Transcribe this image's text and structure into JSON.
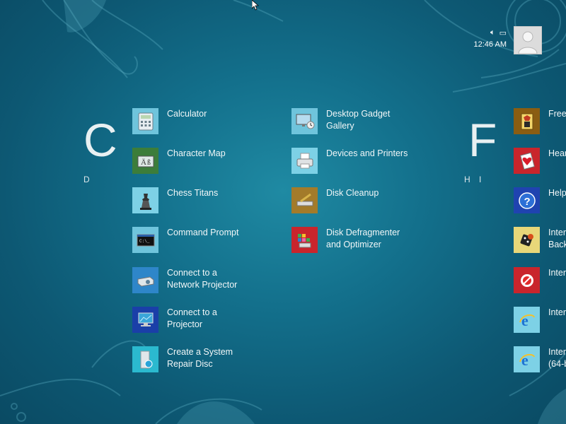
{
  "status": {
    "time": "12:46 AM"
  },
  "groups": {
    "c": {
      "letter": "C",
      "nav": "D"
    },
    "f": {
      "letter": "F",
      "nav_h": "H",
      "nav_i": "I"
    }
  },
  "apps": {
    "col1": [
      {
        "label": "Calculator",
        "icon": "calculator-icon",
        "color": "#6fc4dc"
      },
      {
        "label": "Character Map",
        "icon": "character-map-icon",
        "color": "#3c7d3a"
      },
      {
        "label": "Chess Titans",
        "icon": "chess-icon",
        "color": "#7dd1e6"
      },
      {
        "label": "Command Prompt",
        "icon": "command-prompt-icon",
        "color": "#6fc4dc"
      },
      {
        "label": "Connect to a\nNetwork Projector",
        "icon": "network-projector-icon",
        "color": "#2e86c9"
      },
      {
        "label": "Connect to a\nProjector",
        "icon": "projector-icon",
        "color": "#1a3fa8"
      },
      {
        "label": "Create a System\nRepair Disc",
        "icon": "repair-disc-icon",
        "color": "#2bb9cf"
      }
    ],
    "col2": [
      {
        "label": "Desktop Gadget\nGallery",
        "icon": "gadget-gallery-icon",
        "color": "#6fc4dc"
      },
      {
        "label": "Devices and Printers",
        "icon": "printer-icon",
        "color": "#7dd1e6"
      },
      {
        "label": "Disk Cleanup",
        "icon": "disk-cleanup-icon",
        "color": "#a37b2a"
      },
      {
        "label": "Disk Defragmenter\nand Optimizer",
        "icon": "defragmenter-icon",
        "color": "#c9252c"
      }
    ],
    "col3": [
      {
        "label": "Free",
        "icon": "freecell-icon",
        "color": "#8a5d12"
      },
      {
        "label": "Hear",
        "icon": "hearts-icon",
        "color": "#c9252c"
      },
      {
        "label": "Help",
        "icon": "help-icon",
        "color": "#1f43b0"
      },
      {
        "label": "Inter\nBack",
        "icon": "internet-backgammon-icon",
        "color": "#e8d779"
      },
      {
        "label": "Inter",
        "icon": "internet-game-icon",
        "color": "#c9252c"
      },
      {
        "label": "Inter",
        "icon": "internet-explorer-icon",
        "color": "#7dd1e6"
      },
      {
        "label": "Inter\n(64-b",
        "icon": "internet-explorer-64-icon",
        "color": "#7dd1e6"
      }
    ]
  }
}
